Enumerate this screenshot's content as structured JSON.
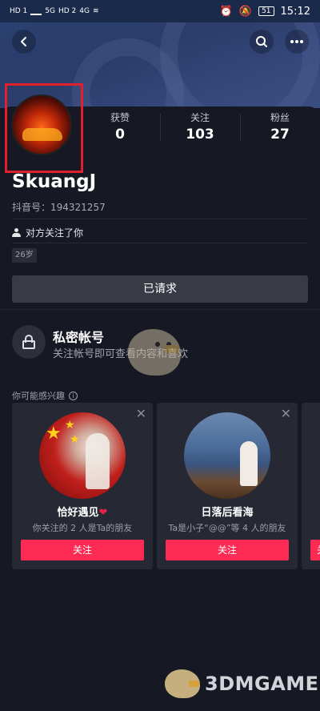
{
  "status_bar": {
    "left_labels": [
      "HD 1",
      "HD 2",
      "5G",
      "4G"
    ],
    "battery": "51",
    "time": "15:12"
  },
  "header": {
    "back_icon": "chevron-left-icon",
    "search_icon": "search-icon",
    "more_icon": "more-dots-icon"
  },
  "profile": {
    "username": "SkuangJ",
    "douyin_id": "抖音号：194321257",
    "follows_you": "对方关注了你",
    "age": "26岁",
    "stats": [
      {
        "label": "获赞",
        "value": "0"
      },
      {
        "label": "关注",
        "value": "103"
      },
      {
        "label": "粉丝",
        "value": "27"
      }
    ],
    "highlight_color": "#e0202c"
  },
  "actions": {
    "requested_label": "已请求"
  },
  "private": {
    "title": "私密帐号",
    "desc": "关注帐号即可查看内容和喜欢"
  },
  "suggestions": {
    "title": "你可能感兴趣",
    "cards": [
      {
        "name": "恰好遇见",
        "name_suffix": "❤",
        "desc": "你关注的 2 人是Ta的朋友",
        "follow_label": "关注"
      },
      {
        "name": "日落后看海",
        "desc": "Ta是小子“@@”等 4 人的朋友",
        "follow_label": "关注"
      },
      {
        "follow_label": "关注"
      }
    ],
    "accent": "#fe2c55"
  },
  "watermark": {
    "text": "3DMGAME"
  }
}
